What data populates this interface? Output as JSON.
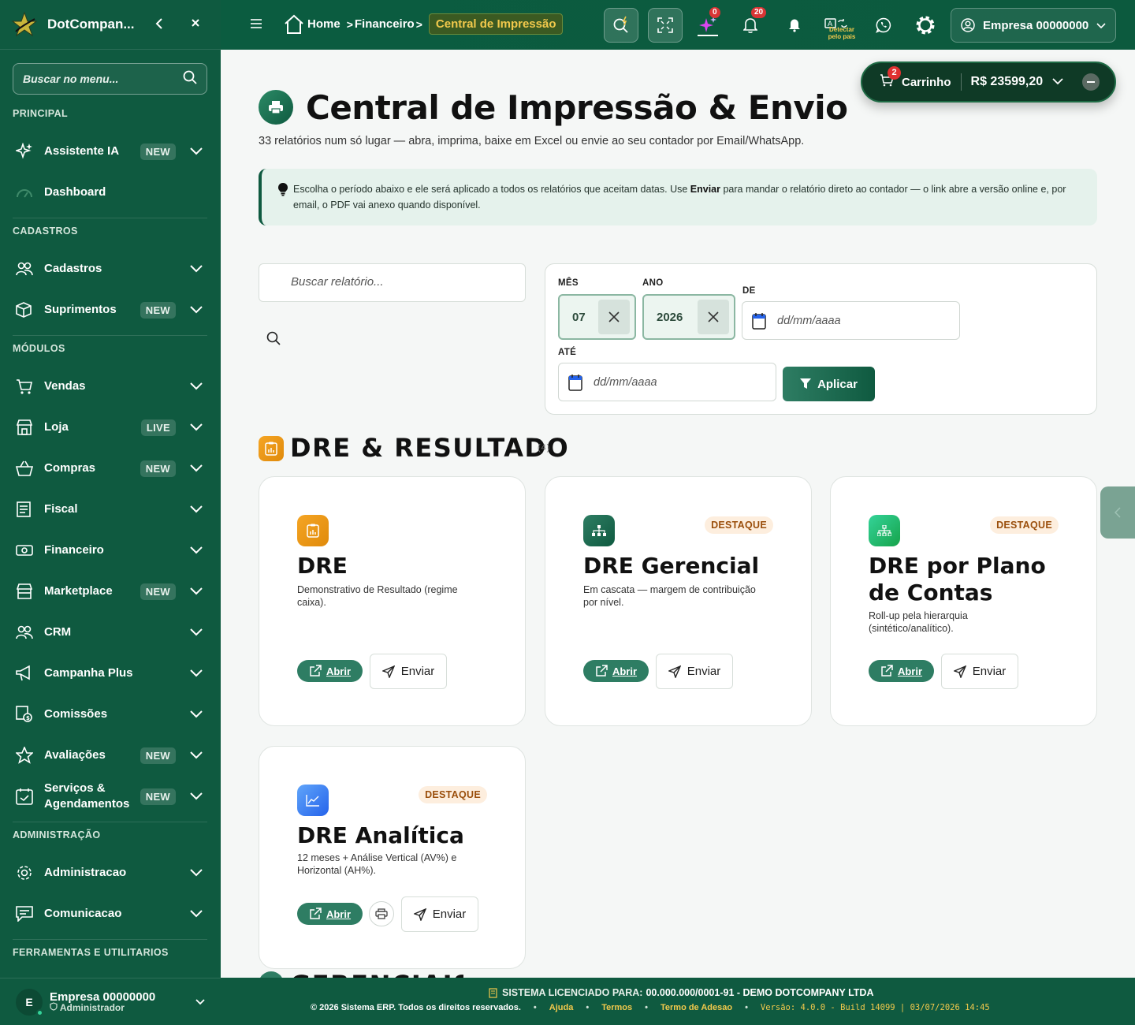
{
  "sidebar": {
    "brand": "DotCompan...",
    "search_placeholder": "Buscar no menu...",
    "sections": [
      "PRINCIPAL",
      "CADASTROS",
      "MÓDULOS",
      "ADMINISTRAÇÃO",
      "FERRAMENTAS E UTILITARIOS"
    ],
    "items": [
      {
        "label": "Assistente IA",
        "badge": "NEW",
        "icon": "sparkles-icon"
      },
      {
        "label": "Dashboard",
        "badge": "",
        "icon": "gauge-icon"
      },
      {
        "label": "Cadastros",
        "badge": "",
        "icon": "users-icon"
      },
      {
        "label": "Suprimentos",
        "badge": "NEW",
        "icon": "box-icon"
      },
      {
        "label": "Vendas",
        "badge": "",
        "icon": "cart-icon"
      },
      {
        "label": "Loja",
        "badge": "LIVE",
        "icon": "store-icon"
      },
      {
        "label": "Compras",
        "badge": "NEW",
        "icon": "basket-icon"
      },
      {
        "label": "Fiscal",
        "badge": "",
        "icon": "receipt-icon"
      },
      {
        "label": "Financeiro",
        "badge": "",
        "icon": "cash-icon"
      },
      {
        "label": "Marketplace",
        "badge": "NEW",
        "icon": "shop-icon"
      },
      {
        "label": "CRM",
        "badge": "",
        "icon": "users-icon"
      },
      {
        "label": "Campanha Plus",
        "badge": "",
        "icon": "megaphone-icon"
      },
      {
        "label": "Comissões",
        "badge": "",
        "icon": "commission-icon"
      },
      {
        "label": "Avaliações",
        "badge": "NEW",
        "icon": "star-icon"
      },
      {
        "label": "Serviços & Agendamentos",
        "badge": "NEW",
        "icon": "calendar-check-icon"
      },
      {
        "label": "Administracao",
        "badge": "",
        "icon": "gear-icon"
      },
      {
        "label": "Comunicacao",
        "badge": "",
        "icon": "chat-icon"
      }
    ],
    "user": {
      "initial": "E",
      "name": "Empresa 00000000",
      "role": "Administrador"
    }
  },
  "topbar": {
    "breadcrumb_home": "Home",
    "breadcrumb_financeiro": "Financeiro",
    "breadcrumb_active": "Central de Impressão",
    "sparkles_count": "0",
    "notifications_count": "20",
    "detect_label": "Detectar pelo pais",
    "company_label": "Empresa 00000000"
  },
  "cart": {
    "count": "2",
    "label": "Carrinho",
    "total": "R$ 23599,20"
  },
  "page": {
    "title": "Central de Impressão & Envio",
    "subtitle": "33 relatórios num só lugar — abra, imprima, baixe em Excel ou envie ao seu contador por Email/WhatsApp.",
    "tip_part1": "Escolha o período abaixo e ele será aplicado a todos os relatórios que aceitam datas. Use ",
    "tip_bold": "Enviar",
    "tip_part2": " para mandar o relatório direto ao contador — o link abre a versão online e, por email, o PDF vai anexo quando disponível.",
    "report_search_placeholder": "Buscar relatório..."
  },
  "filters": {
    "month_label": "MÊS",
    "month_value": "07",
    "year_label": "ANO",
    "year_value": "2026",
    "from_label": "DE",
    "to_label": "ATÉ",
    "date_placeholder": "dd/mm/aaaa",
    "apply_label": "Aplicar"
  },
  "section": {
    "title": "DRE & RESULTADO",
    "count": "(4)",
    "next_title": "GERENCIAIS"
  },
  "cards": [
    {
      "title": "DRE",
      "desc": "Demonstrativo de Resultado (regime caixa).",
      "badge": "",
      "open": "Abrir",
      "send": "Enviar"
    },
    {
      "title": "DRE Gerencial",
      "desc": "Em cascata — margem de contribuição por nível.",
      "badge": "DESTAQUE",
      "open": "Abrir",
      "send": "Enviar"
    },
    {
      "title": "DRE por Plano de Contas",
      "desc": "Roll-up pela hierarquia (sintético/analítico).",
      "badge": "DESTAQUE",
      "open": "Abrir",
      "send": "Enviar"
    },
    {
      "title": "DRE Analítica",
      "desc": "12 meses + Análise Vertical (AV%) e Horizontal (AH%).",
      "badge": "DESTAQUE",
      "open": "Abrir",
      "send": "Enviar"
    }
  ],
  "footer": {
    "license_label": "SISTEMA LICENCIADO PARA:",
    "license_value": "00.000.000/0001-91 - DEMO DOTCOMPANY LTDA",
    "copyright": "© 2026 Sistema ERP. Todos os direitos reservados.",
    "link_help": "Ajuda",
    "link_terms": "Termos",
    "link_adhesion": "Termo de Adesao",
    "version": "Versão: 4.0.0 - Build 14099 | 03/07/2026 14:45"
  },
  "colors": {
    "primary": "#0f5a40",
    "accent": "#f2c94c",
    "badge": "#d93535"
  }
}
